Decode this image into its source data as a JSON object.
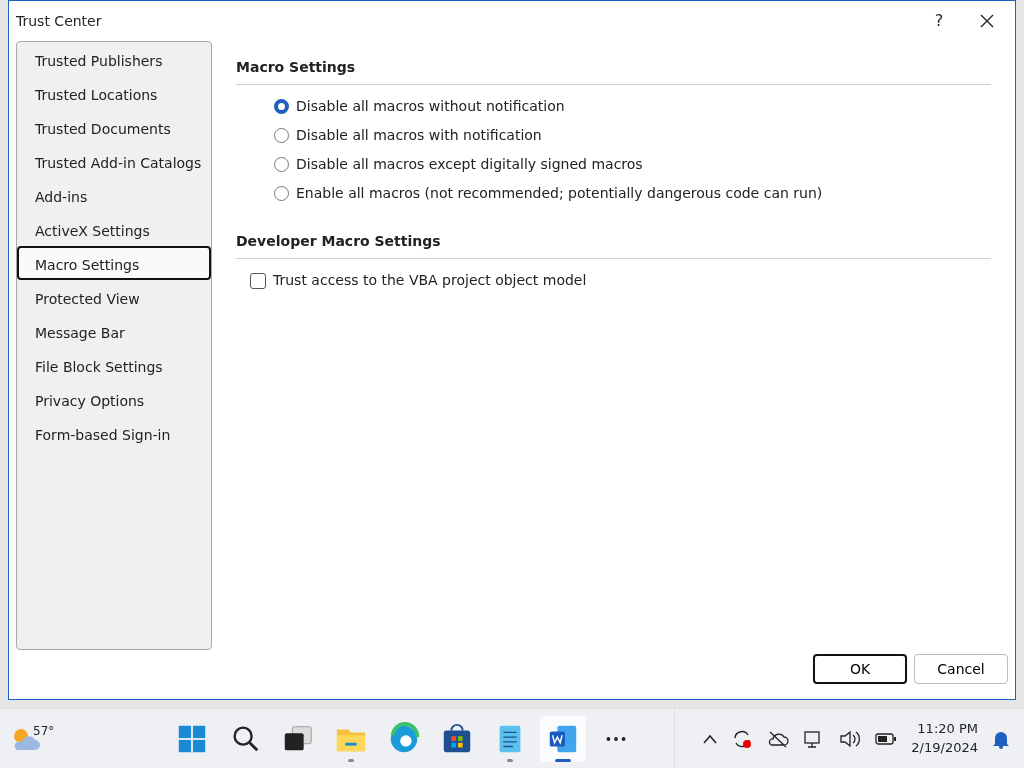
{
  "window": {
    "title": "Trust Center",
    "help": "?"
  },
  "sidebar": {
    "items": [
      {
        "label": "Trusted Publishers",
        "selected": false
      },
      {
        "label": "Trusted Locations",
        "selected": false
      },
      {
        "label": "Trusted Documents",
        "selected": false
      },
      {
        "label": "Trusted Add-in Catalogs",
        "selected": false
      },
      {
        "label": "Add-ins",
        "selected": false
      },
      {
        "label": "ActiveX Settings",
        "selected": false
      },
      {
        "label": "Macro Settings",
        "selected": true
      },
      {
        "label": "Protected View",
        "selected": false
      },
      {
        "label": "Message Bar",
        "selected": false
      },
      {
        "label": "File Block Settings",
        "selected": false
      },
      {
        "label": "Privacy Options",
        "selected": false
      },
      {
        "label": "Form-based Sign-in",
        "selected": false
      }
    ]
  },
  "sections": [
    {
      "title": "Macro Settings",
      "options": [
        {
          "kind": "radio",
          "label": "Disable all macros without notification",
          "selected": true
        },
        {
          "kind": "radio",
          "label": "Disable all macros with notification",
          "selected": false
        },
        {
          "kind": "radio",
          "label": "Disable all macros except digitally signed macros",
          "selected": false
        },
        {
          "kind": "radio",
          "label": "Enable all macros (not recommended; potentially dangerous code can run)",
          "selected": false
        }
      ]
    },
    {
      "title": "Developer Macro Settings",
      "options": [
        {
          "kind": "checkbox",
          "label": "Trust access to the VBA project object model",
          "checked": false
        }
      ]
    }
  ],
  "buttons": [
    {
      "label": "OK",
      "default": true
    },
    {
      "label": "Cancel",
      "default": false
    }
  ],
  "taskbar": {
    "weather": "57°",
    "apps": [
      {
        "kind": "start",
        "running": false,
        "active": false
      },
      {
        "kind": "search",
        "running": false,
        "active": false
      },
      {
        "kind": "taskview",
        "running": false,
        "active": false
      },
      {
        "kind": "folder",
        "running": true,
        "active": false
      },
      {
        "kind": "browser",
        "running": false,
        "active": false
      },
      {
        "kind": "store",
        "running": false,
        "active": false
      },
      {
        "kind": "notepad",
        "running": true,
        "active": false
      },
      {
        "kind": "word",
        "running": true,
        "active": true
      },
      {
        "kind": "more",
        "running": false,
        "active": false
      }
    ],
    "time": "11:20 PM",
    "date": "2/19/2024"
  }
}
